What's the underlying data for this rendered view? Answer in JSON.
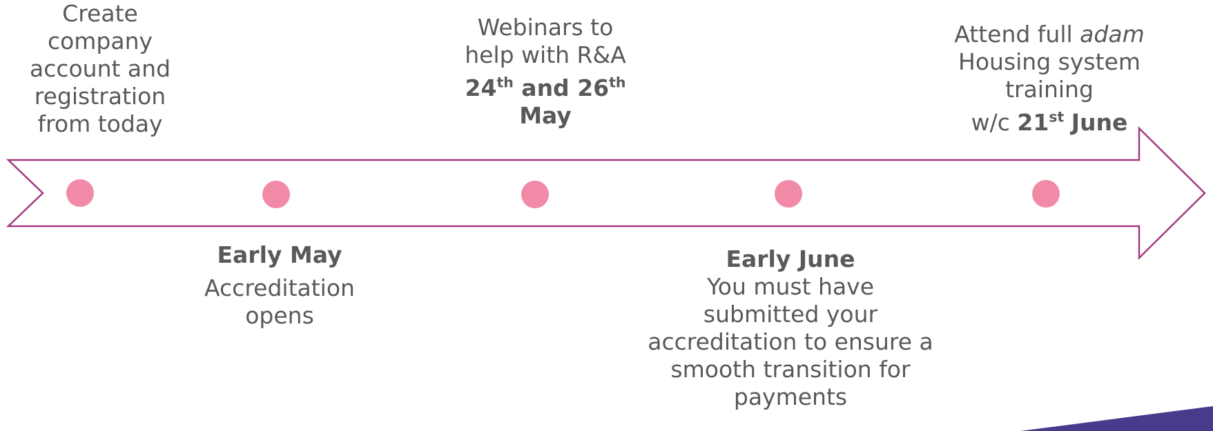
{
  "milestones": [
    {
      "id": "create-account",
      "lines": [
        "Create",
        "company",
        "account and",
        "registration",
        "from today"
      ]
    },
    {
      "id": "webinars",
      "lines": [
        "Webinars to",
        "help with R&A"
      ],
      "date": {
        "first_num": "24",
        "first_suffix": "th",
        "joiner": "and",
        "second_num": "26",
        "second_suffix": "th",
        "month": "May"
      }
    },
    {
      "id": "system-training",
      "line1_prefix": "Attend full ",
      "line1_italic": "adam",
      "lines": [
        "Housing system",
        "training"
      ],
      "date": {
        "prefix": "w/c",
        "num": "21",
        "suffix": "st",
        "month": "June"
      }
    },
    {
      "id": "accreditation-opens",
      "heading": "Early May",
      "lines": [
        "Accreditation",
        "opens"
      ]
    },
    {
      "id": "submit-accreditation",
      "heading": "Early June",
      "lines": [
        "You must have",
        "submitted your",
        "accreditation to ensure a",
        "smooth transition for",
        "payments"
      ]
    }
  ],
  "colors": {
    "arrow_stroke": "#a4387f",
    "dot_fill": "#f08aa6",
    "text": "#595959",
    "accent_shape": "#4a3a8c"
  },
  "chart_data": {
    "type": "timeline",
    "points": [
      {
        "order": 1,
        "text": "Create company account and registration from today"
      },
      {
        "order": 2,
        "text": "Early May Accreditation opens"
      },
      {
        "order": 3,
        "text": "Webinars to help with R&A 24th and 26th May"
      },
      {
        "order": 4,
        "text": "Early June You must have submitted your accreditation to ensure a smooth transition for payments"
      },
      {
        "order": 5,
        "text": "Attend full adam Housing system training w/c 21st June"
      }
    ]
  }
}
